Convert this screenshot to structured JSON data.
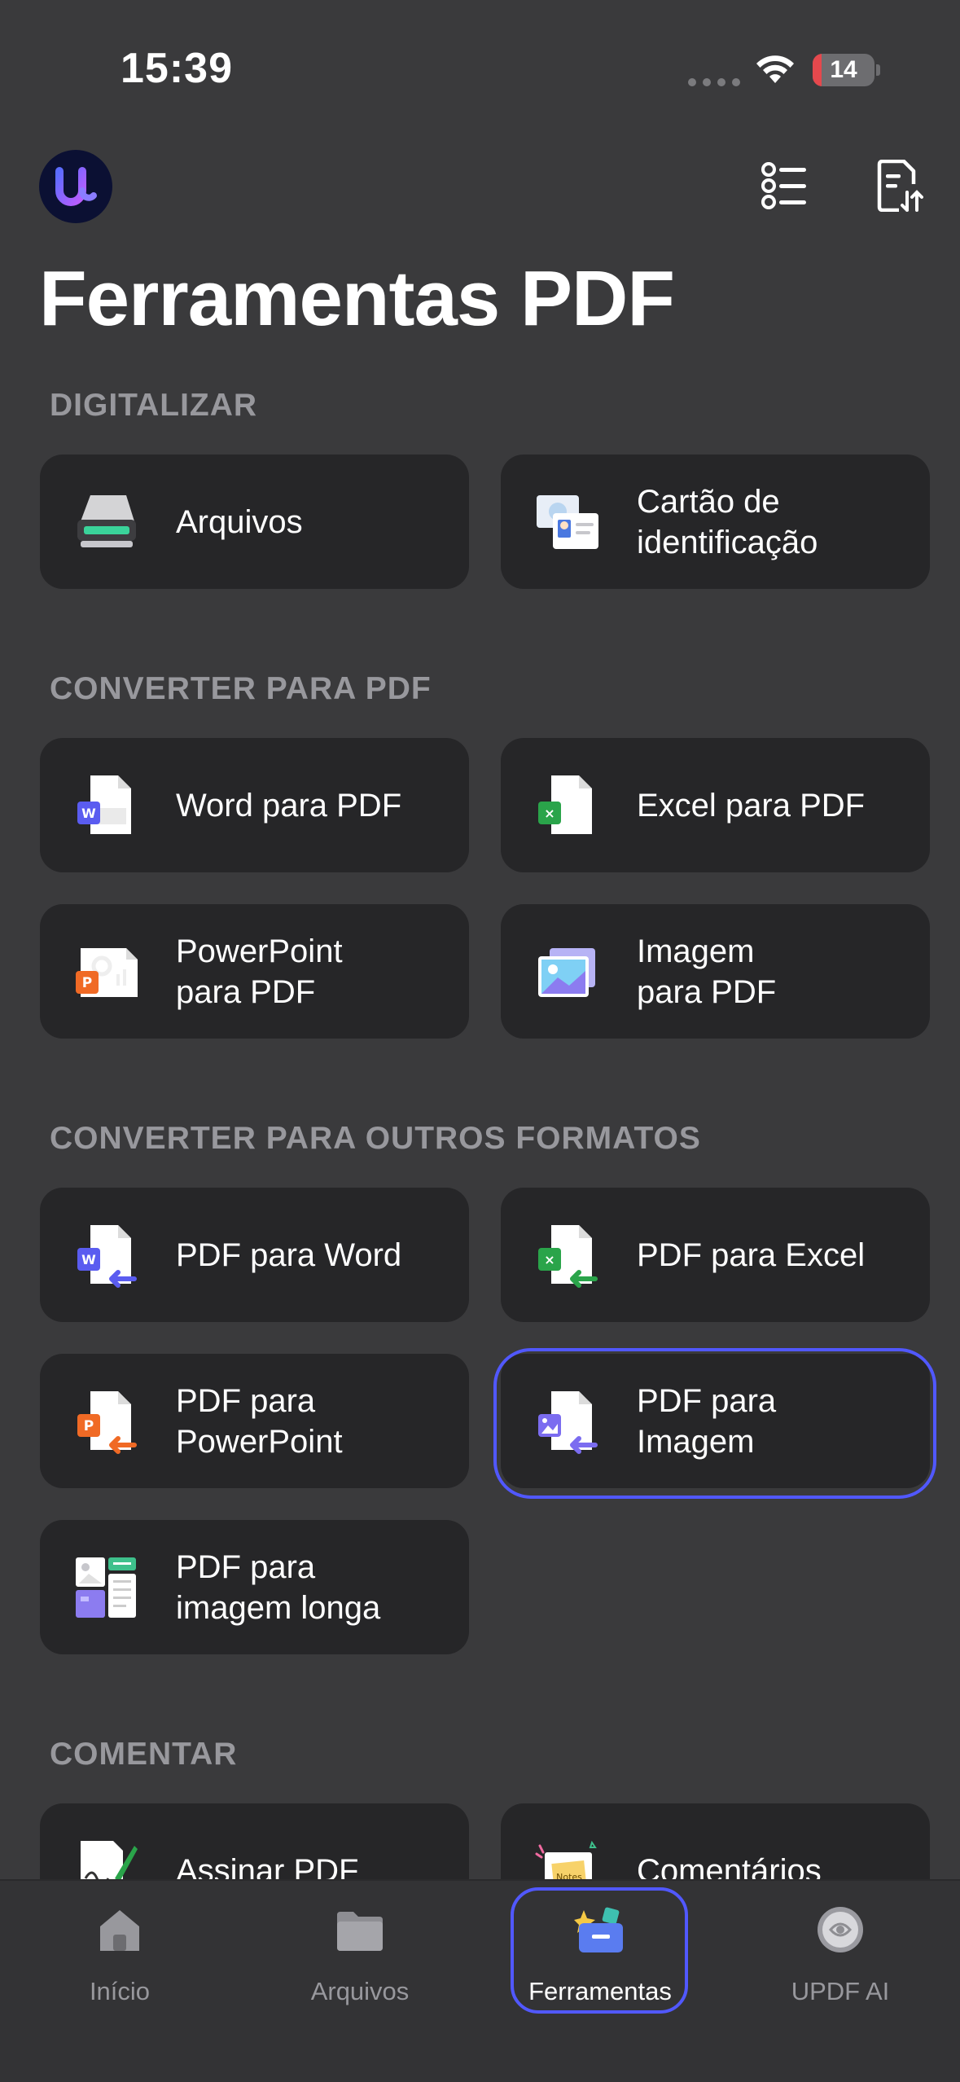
{
  "status_bar": {
    "time": "15:39",
    "battery": "14"
  },
  "header": {
    "title": "Ferramentas PDF"
  },
  "sections": {
    "scan": {
      "title": "DIGITALIZAR",
      "items": [
        "Arquivos",
        "Cartão de\nidentificação"
      ]
    },
    "to_pdf": {
      "title": "CONVERTER PARA PDF",
      "items": [
        "Word para PDF",
        "Excel para PDF",
        "PowerPoint\npara PDF",
        "Imagem\npara PDF"
      ]
    },
    "to_other": {
      "title": "CONVERTER PARA OUTROS FORMATOS",
      "items": [
        "PDF para Word",
        "PDF para Excel",
        "PDF para\nPowerPoint",
        "PDF para\nImagem",
        "PDF para\nimagem longa"
      ]
    },
    "comment": {
      "title": "COMENTAR",
      "items": [
        "Assinar PDF",
        "Comentários"
      ]
    }
  },
  "tab_bar": {
    "items": [
      {
        "label": "Início"
      },
      {
        "label": "Arquivos"
      },
      {
        "label": "Ferramentas"
      },
      {
        "label": "UPDF AI"
      }
    ],
    "active": "Ferramentas"
  },
  "colors": {
    "background": "#3a3a3c",
    "card": "#262628",
    "accent_highlight": "#5158ff",
    "section_title": "#98989d"
  }
}
